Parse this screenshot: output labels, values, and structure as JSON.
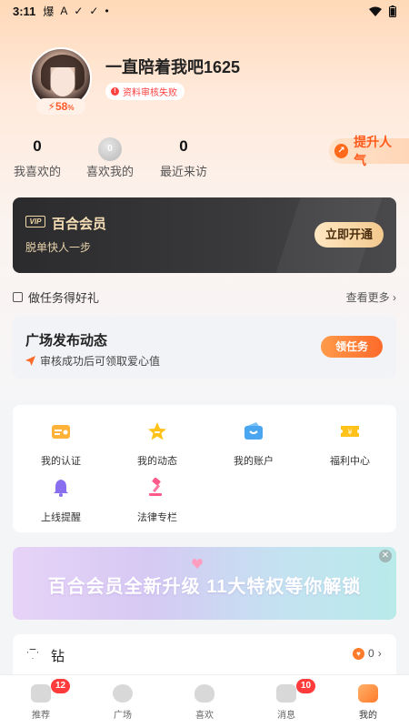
{
  "status_bar": {
    "time": "3:11",
    "icons": [
      "爆",
      "A",
      "✓",
      "✓",
      "•"
    ]
  },
  "profile": {
    "username": "一直陪着我吧1625",
    "review_status": "资料审核失败",
    "progress_text": "58",
    "progress_unit": "%"
  },
  "stats": [
    {
      "value": "0",
      "label": "我喜欢的"
    },
    {
      "value": "0",
      "label": "喜欢我的"
    },
    {
      "value": "0",
      "label": "最近来访"
    }
  ],
  "boost_label": "提升人气",
  "vip": {
    "tag": "VIP",
    "title": "百合会员",
    "subtitle": "脱单快人一步",
    "button": "立即开通"
  },
  "tasks": {
    "title": "做任务得好礼",
    "more": "查看更多",
    "card_title": "广场发布动态",
    "card_subtitle": "审核成功后可领取爱心值",
    "card_button": "领任务"
  },
  "grid": [
    {
      "label": "我的认证",
      "icon": "id-card-icon"
    },
    {
      "label": "我的动态",
      "icon": "star-icon"
    },
    {
      "label": "我的账户",
      "icon": "wallet-icon"
    },
    {
      "label": "福利中心",
      "icon": "coupon-icon"
    },
    {
      "label": "上线提醒",
      "icon": "bell-icon"
    },
    {
      "label": "法律专栏",
      "icon": "gavel-icon"
    }
  ],
  "banner": {
    "text": "百合会员全新升级  11大特权等你解锁"
  },
  "diamond": {
    "label": "钻",
    "count": "0"
  },
  "bottom_nav": [
    {
      "label": "推荐",
      "badge": "12"
    },
    {
      "label": "广场",
      "badge": ""
    },
    {
      "label": "喜欢",
      "badge": ""
    },
    {
      "label": "消息",
      "badge": "10"
    },
    {
      "label": "我的",
      "badge": ""
    }
  ],
  "colors": {
    "accent": "#ff6a2a",
    "vip_gold": "#f3d8a8",
    "badge_red": "#ff3b3b"
  }
}
